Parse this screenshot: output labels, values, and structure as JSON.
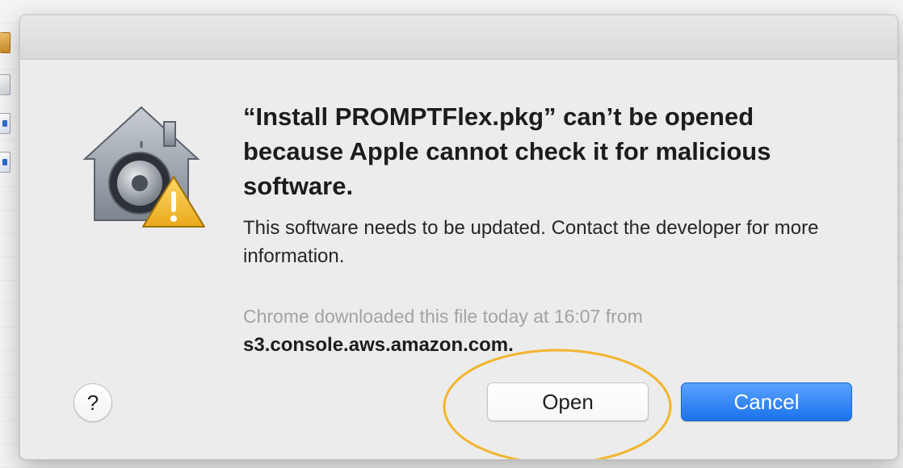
{
  "dialog": {
    "title": "“Install PROMPTFlex.pkg” can’t be opened because Apple cannot check it for malicious software.",
    "message": "This software needs to be updated. Contact the developer for more information.",
    "source_text": "Chrome downloaded this file today at 16:07 from",
    "source_domain": "s3.console.aws.amazon.com.",
    "help_label": "?",
    "open_label": "Open",
    "cancel_label": "Cancel",
    "icon": "gatekeeper-warning-icon"
  },
  "colors": {
    "dialog_bg": "#ececec",
    "cancel_blue": "#1a72ea",
    "highlight": "#f2b52e",
    "warning_yellow": "#f5c43b"
  }
}
